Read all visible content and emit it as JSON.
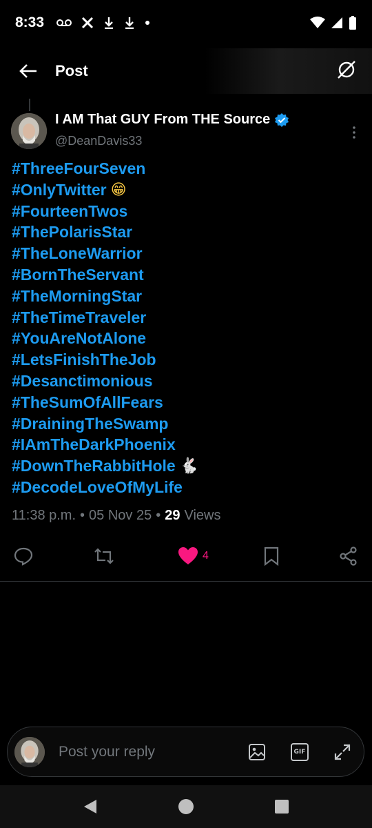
{
  "status_bar": {
    "time": "8:33",
    "left_icons": [
      "voicemail-icon",
      "x-logo-icon",
      "download-icon",
      "download-icon",
      "dot-icon"
    ],
    "right_icons": [
      "wifi-icon",
      "signal-icon",
      "battery-icon"
    ]
  },
  "header": {
    "title": "Post",
    "back_icon": "arrow-left-icon",
    "right_icon": "grok-icon"
  },
  "tweet": {
    "display_name": "I AM That GUY From THE Source",
    "verified": true,
    "handle": "@DeanDavis33",
    "hashtags": [
      {
        "text": "#ThreeFourSeven",
        "emoji": ""
      },
      {
        "text": "#OnlyTwitter",
        "emoji": "😁"
      },
      {
        "text": "#FourteenTwos",
        "emoji": ""
      },
      {
        "text": "#ThePolarisStar",
        "emoji": ""
      },
      {
        "text": "#TheLoneWarrior",
        "emoji": ""
      },
      {
        "text": "#BornTheServant",
        "emoji": ""
      },
      {
        "text": "#TheMorningStar",
        "emoji": ""
      },
      {
        "text": "#TheTimeTraveler",
        "emoji": ""
      },
      {
        "text": "#YouAreNotAlone",
        "emoji": ""
      },
      {
        "text": "#LetsFinishTheJob",
        "emoji": ""
      },
      {
        "text": "#Desanctimonious",
        "emoji": ""
      },
      {
        "text": "#TheSumOfAllFears",
        "emoji": ""
      },
      {
        "text": "#DrainingTheSwamp",
        "emoji": ""
      },
      {
        "text": "#IAmTheDarkPhoenix",
        "emoji": ""
      },
      {
        "text": "#DownTheRabbitHole",
        "emoji": "🐇"
      },
      {
        "text": "#DecodeLoveOfMyLife",
        "emoji": ""
      }
    ],
    "time": "11:38 p.m.",
    "sep1": "•",
    "date": "05 Nov 25",
    "sep2": "•",
    "views_count": "29",
    "views_label": "Views",
    "like_count": "4",
    "colors": {
      "link": "#1d9bf0",
      "like": "#f91880",
      "muted": "#71767b"
    }
  },
  "actions": {
    "icons": [
      "reply-icon",
      "retweet-icon",
      "heart-icon",
      "bookmark-icon",
      "share-icon"
    ]
  },
  "reply_bar": {
    "placeholder": "Post your reply",
    "gif_label": "GIF",
    "icons": [
      "image-icon",
      "gif-icon",
      "expand-icon"
    ]
  },
  "nav_bar": {
    "icons": [
      "back-triangle-icon",
      "home-circle-icon",
      "recents-square-icon"
    ]
  }
}
